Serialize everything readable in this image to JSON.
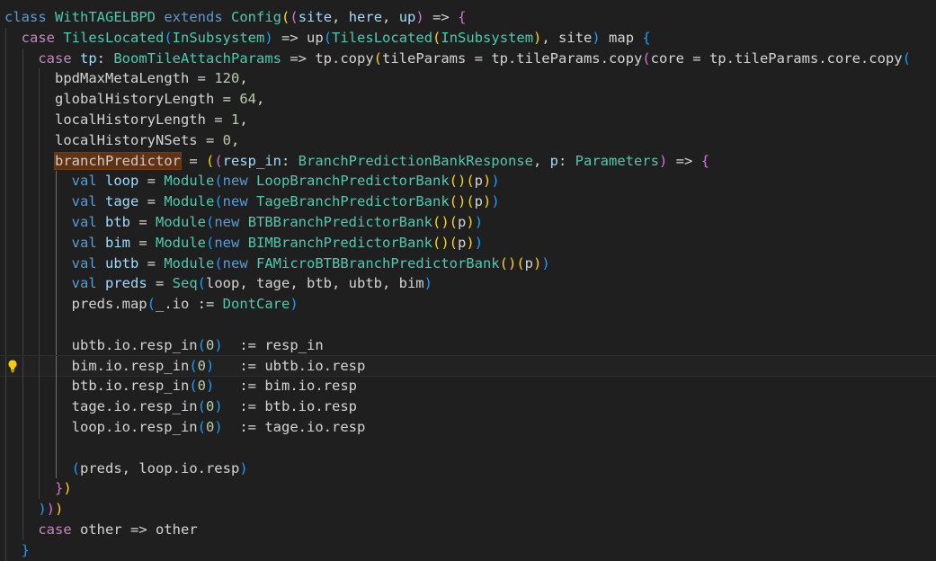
{
  "editor": {
    "language": "scala",
    "theme_colors": {
      "background": "#1f1f1f",
      "keyword": "#569cd6",
      "control": "#c586c0",
      "type": "#4ec9b0",
      "function": "#dcdcaa",
      "variable": "#9cdcfe",
      "number": "#b5cea8",
      "bracket_1": "#ffd700",
      "bracket_2": "#da70d6",
      "bracket_3": "#179fff",
      "highlight": "#613214"
    },
    "lightbulb_icon": "lightbulb-icon",
    "lines": [
      {
        "indent": 0,
        "tokens": [
          {
            "t": "kw",
            "v": "class"
          },
          {
            "t": "pl",
            "v": " "
          },
          {
            "t": "typ",
            "v": "WithTAGELBPD"
          },
          {
            "t": "pl",
            "v": " "
          },
          {
            "t": "kw",
            "v": "extends"
          },
          {
            "t": "pl",
            "v": " "
          },
          {
            "t": "typ",
            "v": "Config"
          },
          {
            "t": "b1",
            "v": "("
          },
          {
            "t": "b2",
            "v": "("
          },
          {
            "t": "var",
            "v": "site"
          },
          {
            "t": "pl",
            "v": ", "
          },
          {
            "t": "var",
            "v": "here"
          },
          {
            "t": "pl",
            "v": ", "
          },
          {
            "t": "var",
            "v": "up"
          },
          {
            "t": "b2",
            "v": ")"
          },
          {
            "t": "pl",
            "v": " "
          },
          {
            "t": "op",
            "v": "=>"
          },
          {
            "t": "pl",
            "v": " "
          },
          {
            "t": "b2",
            "v": "{"
          }
        ]
      },
      {
        "indent": 1,
        "tokens": [
          {
            "t": "ctl",
            "v": "case"
          },
          {
            "t": "pl",
            "v": " "
          },
          {
            "t": "typ",
            "v": "TilesLocated"
          },
          {
            "t": "b3",
            "v": "("
          },
          {
            "t": "typ",
            "v": "InSubsystem"
          },
          {
            "t": "b3",
            "v": ")"
          },
          {
            "t": "pl",
            "v": " "
          },
          {
            "t": "op",
            "v": "=>"
          },
          {
            "t": "pl",
            "v": " "
          },
          {
            "t": "pl",
            "v": "up"
          },
          {
            "t": "b3",
            "v": "("
          },
          {
            "t": "typ",
            "v": "TilesLocated"
          },
          {
            "t": "b1",
            "v": "("
          },
          {
            "t": "typ",
            "v": "InSubsystem"
          },
          {
            "t": "b1",
            "v": ")"
          },
          {
            "t": "pl",
            "v": ", site"
          },
          {
            "t": "b3",
            "v": ")"
          },
          {
            "t": "pl",
            "v": " map "
          },
          {
            "t": "b3",
            "v": "{"
          }
        ]
      },
      {
        "indent": 2,
        "tokens": [
          {
            "t": "ctl",
            "v": "case"
          },
          {
            "t": "pl",
            "v": " "
          },
          {
            "t": "var",
            "v": "tp"
          },
          {
            "t": "pl",
            "v": ": "
          },
          {
            "t": "typ",
            "v": "BoomTileAttachParams"
          },
          {
            "t": "pl",
            "v": " "
          },
          {
            "t": "op",
            "v": "=>"
          },
          {
            "t": "pl",
            "v": " tp.copy"
          },
          {
            "t": "b1",
            "v": "("
          },
          {
            "t": "pl",
            "v": "tileParams = tp.tileParams.copy"
          },
          {
            "t": "b2",
            "v": "("
          },
          {
            "t": "pl",
            "v": "core = tp.tileParams.core.copy"
          },
          {
            "t": "b3",
            "v": "("
          }
        ]
      },
      {
        "indent": 3,
        "tokens": [
          {
            "t": "pl",
            "v": "bpdMaxMetaLength = "
          },
          {
            "t": "num",
            "v": "120"
          },
          {
            "t": "pl",
            "v": ","
          }
        ]
      },
      {
        "indent": 3,
        "tokens": [
          {
            "t": "pl",
            "v": "globalHistoryLength = "
          },
          {
            "t": "num",
            "v": "64"
          },
          {
            "t": "pl",
            "v": ","
          }
        ]
      },
      {
        "indent": 3,
        "tokens": [
          {
            "t": "pl",
            "v": "localHistoryLength = "
          },
          {
            "t": "num",
            "v": "1"
          },
          {
            "t": "pl",
            "v": ","
          }
        ]
      },
      {
        "indent": 3,
        "tokens": [
          {
            "t": "pl",
            "v": "localHistoryNSets = "
          },
          {
            "t": "num",
            "v": "0"
          },
          {
            "t": "pl",
            "v": ","
          }
        ]
      },
      {
        "indent": 3,
        "tokens": [
          {
            "t": "hl",
            "v": "branchPredictor"
          },
          {
            "t": "pl",
            "v": " = "
          },
          {
            "t": "b1",
            "v": "("
          },
          {
            "t": "b2",
            "v": "("
          },
          {
            "t": "var",
            "v": "resp_in"
          },
          {
            "t": "pl",
            "v": ": "
          },
          {
            "t": "typ",
            "v": "BranchPredictionBankResponse"
          },
          {
            "t": "pl",
            "v": ", "
          },
          {
            "t": "var",
            "v": "p"
          },
          {
            "t": "pl",
            "v": ": "
          },
          {
            "t": "typ",
            "v": "Parameters"
          },
          {
            "t": "b2",
            "v": ")"
          },
          {
            "t": "pl",
            "v": " "
          },
          {
            "t": "op",
            "v": "=>"
          },
          {
            "t": "pl",
            "v": " "
          },
          {
            "t": "b2",
            "v": "{"
          }
        ]
      },
      {
        "indent": 4,
        "tokens": [
          {
            "t": "kw",
            "v": "val"
          },
          {
            "t": "pl",
            "v": " "
          },
          {
            "t": "var",
            "v": "loop"
          },
          {
            "t": "pl",
            "v": " = "
          },
          {
            "t": "typ",
            "v": "Module"
          },
          {
            "t": "b3",
            "v": "("
          },
          {
            "t": "kw",
            "v": "new"
          },
          {
            "t": "pl",
            "v": " "
          },
          {
            "t": "typ",
            "v": "LoopBranchPredictorBank"
          },
          {
            "t": "b1",
            "v": "()"
          },
          {
            "t": "b1",
            "v": "("
          },
          {
            "t": "pl",
            "v": "p"
          },
          {
            "t": "b1",
            "v": ")"
          },
          {
            "t": "b3",
            "v": ")"
          }
        ]
      },
      {
        "indent": 4,
        "tokens": [
          {
            "t": "kw",
            "v": "val"
          },
          {
            "t": "pl",
            "v": " "
          },
          {
            "t": "var",
            "v": "tage"
          },
          {
            "t": "pl",
            "v": " = "
          },
          {
            "t": "typ",
            "v": "Module"
          },
          {
            "t": "b3",
            "v": "("
          },
          {
            "t": "kw",
            "v": "new"
          },
          {
            "t": "pl",
            "v": " "
          },
          {
            "t": "typ",
            "v": "TageBranchPredictorBank"
          },
          {
            "t": "b1",
            "v": "()"
          },
          {
            "t": "b1",
            "v": "("
          },
          {
            "t": "pl",
            "v": "p"
          },
          {
            "t": "b1",
            "v": ")"
          },
          {
            "t": "b3",
            "v": ")"
          }
        ]
      },
      {
        "indent": 4,
        "tokens": [
          {
            "t": "kw",
            "v": "val"
          },
          {
            "t": "pl",
            "v": " "
          },
          {
            "t": "var",
            "v": "btb"
          },
          {
            "t": "pl",
            "v": " = "
          },
          {
            "t": "typ",
            "v": "Module"
          },
          {
            "t": "b3",
            "v": "("
          },
          {
            "t": "kw",
            "v": "new"
          },
          {
            "t": "pl",
            "v": " "
          },
          {
            "t": "typ",
            "v": "BTBBranchPredictorBank"
          },
          {
            "t": "b1",
            "v": "()"
          },
          {
            "t": "b1",
            "v": "("
          },
          {
            "t": "pl",
            "v": "p"
          },
          {
            "t": "b1",
            "v": ")"
          },
          {
            "t": "b3",
            "v": ")"
          }
        ]
      },
      {
        "indent": 4,
        "tokens": [
          {
            "t": "kw",
            "v": "val"
          },
          {
            "t": "pl",
            "v": " "
          },
          {
            "t": "var",
            "v": "bim"
          },
          {
            "t": "pl",
            "v": " = "
          },
          {
            "t": "typ",
            "v": "Module"
          },
          {
            "t": "b3",
            "v": "("
          },
          {
            "t": "kw",
            "v": "new"
          },
          {
            "t": "pl",
            "v": " "
          },
          {
            "t": "typ",
            "v": "BIMBranchPredictorBank"
          },
          {
            "t": "b1",
            "v": "()"
          },
          {
            "t": "b1",
            "v": "("
          },
          {
            "t": "pl",
            "v": "p"
          },
          {
            "t": "b1",
            "v": ")"
          },
          {
            "t": "b3",
            "v": ")"
          }
        ]
      },
      {
        "indent": 4,
        "tokens": [
          {
            "t": "kw",
            "v": "val"
          },
          {
            "t": "pl",
            "v": " "
          },
          {
            "t": "var",
            "v": "ubtb"
          },
          {
            "t": "pl",
            "v": " = "
          },
          {
            "t": "typ",
            "v": "Module"
          },
          {
            "t": "b3",
            "v": "("
          },
          {
            "t": "kw",
            "v": "new"
          },
          {
            "t": "pl",
            "v": " "
          },
          {
            "t": "typ",
            "v": "FAMicroBTBBranchPredictorBank"
          },
          {
            "t": "b1",
            "v": "()"
          },
          {
            "t": "b1",
            "v": "("
          },
          {
            "t": "pl",
            "v": "p"
          },
          {
            "t": "b1",
            "v": ")"
          },
          {
            "t": "b3",
            "v": ")"
          }
        ]
      },
      {
        "indent": 4,
        "tokens": [
          {
            "t": "kw",
            "v": "val"
          },
          {
            "t": "pl",
            "v": " "
          },
          {
            "t": "var",
            "v": "preds"
          },
          {
            "t": "pl",
            "v": " = "
          },
          {
            "t": "typ",
            "v": "Seq"
          },
          {
            "t": "b3",
            "v": "("
          },
          {
            "t": "pl",
            "v": "loop, tage, btb, ubtb, bim"
          },
          {
            "t": "b3",
            "v": ")"
          }
        ]
      },
      {
        "indent": 4,
        "tokens": [
          {
            "t": "pl",
            "v": "preds.map"
          },
          {
            "t": "b3",
            "v": "("
          },
          {
            "t": "pl",
            "v": "_.io := "
          },
          {
            "t": "typ",
            "v": "DontCare"
          },
          {
            "t": "b3",
            "v": ")"
          }
        ]
      },
      {
        "indent": 4,
        "tokens": []
      },
      {
        "indent": 4,
        "tokens": [
          {
            "t": "pl",
            "v": "ubtb.io.resp_in"
          },
          {
            "t": "b3",
            "v": "("
          },
          {
            "t": "num",
            "v": "0"
          },
          {
            "t": "b3",
            "v": ")"
          },
          {
            "t": "pl",
            "v": "  := resp_in"
          }
        ]
      },
      {
        "indent": 4,
        "current": true,
        "bulb": true,
        "tokens": [
          {
            "t": "pl",
            "v": "bim.io.resp_in"
          },
          {
            "t": "b3",
            "v": "("
          },
          {
            "t": "num",
            "v": "0"
          },
          {
            "t": "b3",
            "v": ")"
          },
          {
            "t": "pl",
            "v": "   := ubtb.io.resp"
          }
        ]
      },
      {
        "indent": 4,
        "tokens": [
          {
            "t": "pl",
            "v": "btb.io.resp_in"
          },
          {
            "t": "b3",
            "v": "("
          },
          {
            "t": "num",
            "v": "0"
          },
          {
            "t": "b3",
            "v": ")"
          },
          {
            "t": "pl",
            "v": "   := bim.io.resp"
          }
        ]
      },
      {
        "indent": 4,
        "tokens": [
          {
            "t": "pl",
            "v": "tage.io.resp_in"
          },
          {
            "t": "b3",
            "v": "("
          },
          {
            "t": "num",
            "v": "0"
          },
          {
            "t": "b3",
            "v": ")"
          },
          {
            "t": "pl",
            "v": "  := btb.io.resp"
          }
        ]
      },
      {
        "indent": 4,
        "tokens": [
          {
            "t": "pl",
            "v": "loop.io.resp_in"
          },
          {
            "t": "b3",
            "v": "("
          },
          {
            "t": "num",
            "v": "0"
          },
          {
            "t": "b3",
            "v": ")"
          },
          {
            "t": "pl",
            "v": "  := tage.io.resp"
          }
        ]
      },
      {
        "indent": 4,
        "tokens": []
      },
      {
        "indent": 4,
        "tokens": [
          {
            "t": "b3",
            "v": "("
          },
          {
            "t": "pl",
            "v": "preds, loop.io.resp"
          },
          {
            "t": "b3",
            "v": ")"
          }
        ]
      },
      {
        "indent": 3,
        "tokens": [
          {
            "t": "b2",
            "v": "}"
          },
          {
            "t": "b1",
            "v": ")"
          }
        ]
      },
      {
        "indent": 2,
        "tokens": [
          {
            "t": "b3",
            "v": ")"
          },
          {
            "t": "b2",
            "v": ")"
          },
          {
            "t": "b1",
            "v": ")"
          }
        ]
      },
      {
        "indent": 2,
        "tokens": [
          {
            "t": "ctl",
            "v": "case"
          },
          {
            "t": "pl",
            "v": " other "
          },
          {
            "t": "op",
            "v": "=>"
          },
          {
            "t": "pl",
            "v": " other"
          }
        ]
      },
      {
        "indent": 1,
        "tokens": [
          {
            "t": "b3",
            "v": "}"
          }
        ]
      }
    ]
  }
}
